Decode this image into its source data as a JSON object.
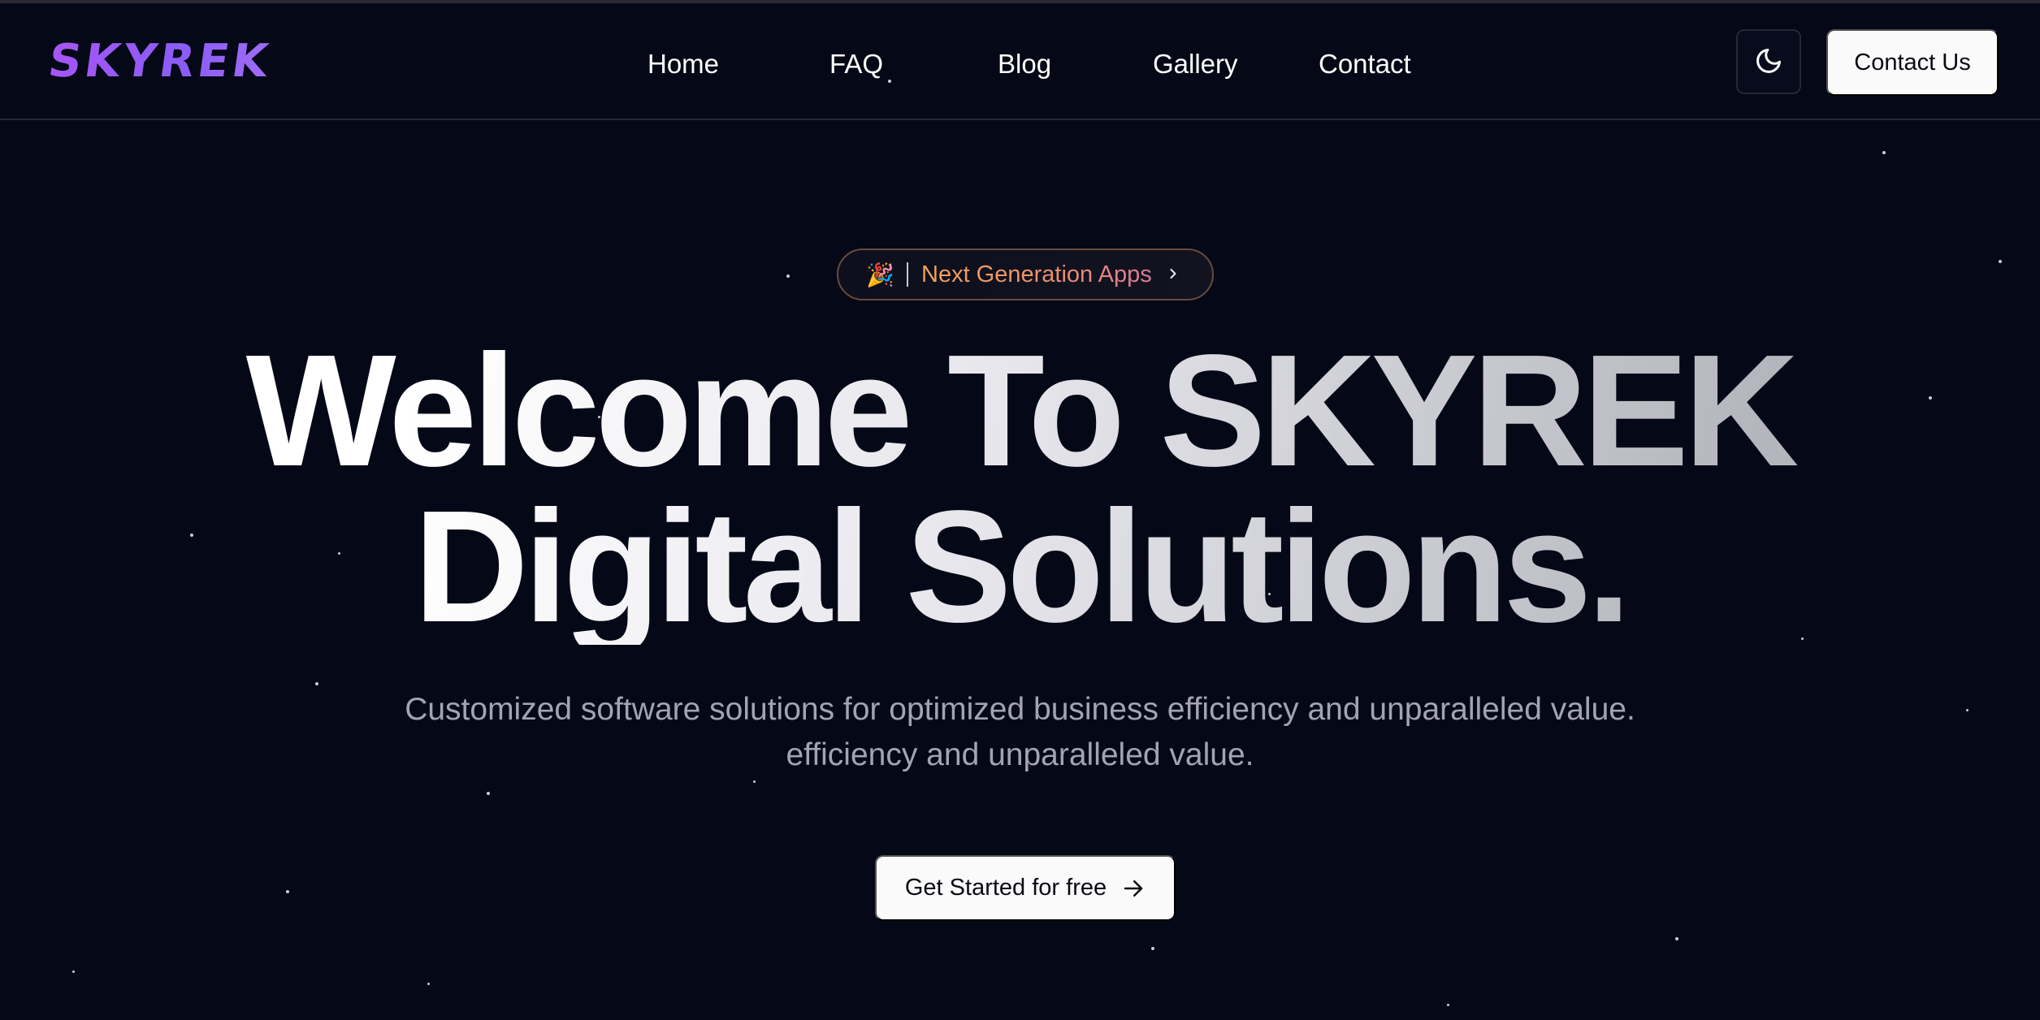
{
  "brand": {
    "logo_text": "SKYREK",
    "accent": "#8b5cf6"
  },
  "nav": {
    "items": [
      {
        "label": "Home"
      },
      {
        "label": "FAQ"
      },
      {
        "label": "Blog"
      },
      {
        "label": "Gallery"
      },
      {
        "label": "Contact"
      }
    ]
  },
  "header": {
    "theme_toggle_icon": "moon-icon",
    "contact_label": "Contact Us"
  },
  "hero": {
    "badge": {
      "emoji": "🎉",
      "text": "Next Generation Apps",
      "icon": "chevron-right-icon"
    },
    "title_line1": "Welcome To SKYREK",
    "title_line2": "Digital Solutions.",
    "subtitle_line1": "Customized software solutions for optimized business efficiency and unparalleled value.",
    "subtitle_line2": "efficiency and unparalleled value.",
    "cta_label": "Get Started for free",
    "cta_icon": "arrow-right-icon"
  },
  "colors": {
    "background": "#050816",
    "button_bg": "#fafafa",
    "badge_text": "#f2a35a"
  }
}
